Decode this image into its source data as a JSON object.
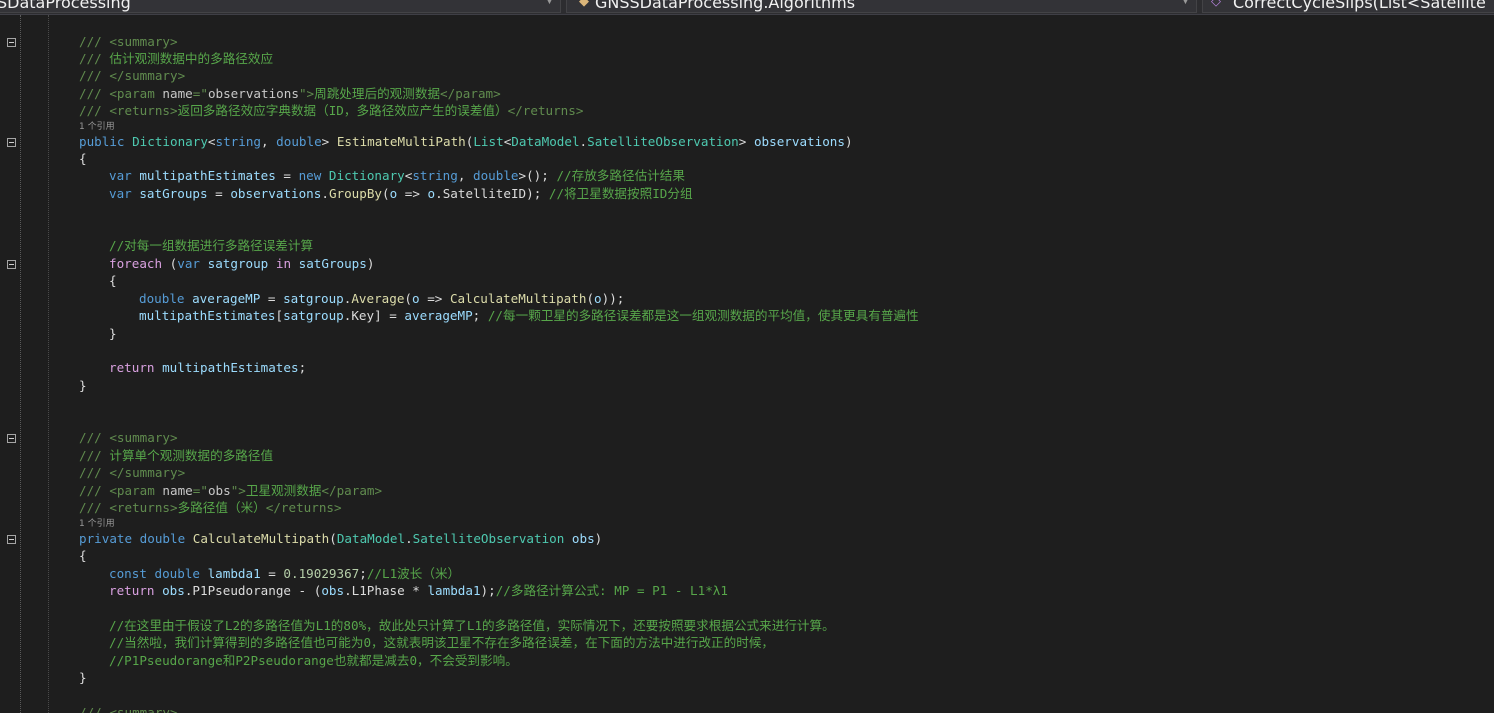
{
  "navbar": {
    "project": "SDataProcessing",
    "class_name": "GNSSDataProcessing.Algorithms",
    "member": "CorrectCycleSlips(List<Satellite",
    "arrow": "▼"
  },
  "code": {
    "l1": {
      "a": "/// ",
      "b": "<summary>"
    },
    "l2": {
      "a": "/// ",
      "b": "估计观测数据中的多路径效应"
    },
    "l3": {
      "a": "/// ",
      "b": "</summary>"
    },
    "l4": {
      "a": "/// ",
      "b": "<param ",
      "c": "name",
      "d": "=\"",
      "e": "observations",
      "f": "\">",
      "g": "周跳处理后的观测数据",
      "h": "</param>"
    },
    "l5": {
      "a": "/// ",
      "b": "<returns>",
      "c": "返回多路径效应字典数据（ID，多路径效应产生的误差值）",
      "d": "</returns>"
    },
    "lens1": "1 个引用",
    "l6": {
      "a": "public ",
      "b": "Dictionary",
      "c": "<",
      "d": "string",
      "e": ", ",
      "f": "double",
      "g": "> ",
      "h": "EstimateMultiPath",
      "i": "(",
      "j": "List",
      "k": "<",
      "l": "DataModel",
      "m": ".",
      "n": "SatelliteObservation",
      "o": "> ",
      "p": "observations",
      "q": ")"
    },
    "l7": "{",
    "l8": {
      "a": "var ",
      "b": "multipathEstimates",
      "c": " = ",
      "d": "new ",
      "e": "Dictionary",
      "f": "<",
      "g": "string",
      "h": ", ",
      "i": "double",
      "j": ">(); ",
      "k": "//存放多路径估计结果"
    },
    "l9": {
      "a": "var ",
      "b": "satGroups",
      "c": " = ",
      "d": "observations",
      "e": ".",
      "f": "GroupBy",
      "g": "(",
      "h": "o",
      "i": " => ",
      "j": "o",
      "k": ".SatelliteID); ",
      "l": "//将卫星数据按照ID分组"
    },
    "l10": "//对每一组数据进行多路径误差计算",
    "l11": {
      "a": "foreach ",
      "b": "(",
      "c": "var ",
      "d": "satgroup ",
      "e": "in ",
      "f": "satGroups",
      "g": ")"
    },
    "l12": "{",
    "l13": {
      "a": "double ",
      "b": "averageMP",
      "c": " = ",
      "d": "satgroup",
      "e": ".",
      "f": "Average",
      "g": "(",
      "h": "o",
      "i": " => ",
      "j": "CalculateMultipath",
      "k": "(",
      "l": "o",
      "m": "));"
    },
    "l14": {
      "a": "multipathEstimates",
      "b": "[",
      "c": "satgroup",
      "d": ".Key] = ",
      "e": "averageMP",
      "f": "; ",
      "g": "//每一颗卫星的多路径误差都是这一组观测数据的平均值，使其更具有普遍性"
    },
    "l15": "}",
    "l16": {
      "a": "return ",
      "b": "multipathEstimates",
      "c": ";"
    },
    "l17": "}",
    "l18": {
      "a": "/// ",
      "b": "<summary>"
    },
    "l19": {
      "a": "/// ",
      "b": "计算单个观测数据的多路径值"
    },
    "l20": {
      "a": "/// ",
      "b": "</summary>"
    },
    "l21": {
      "a": "/// ",
      "b": "<param ",
      "c": "name",
      "d": "=\"",
      "e": "obs",
      "f": "\">",
      "g": "卫星观测数据",
      "h": "</param>"
    },
    "l22": {
      "a": "/// ",
      "b": "<returns>",
      "c": "多路径值（米）",
      "d": "</returns>"
    },
    "lens2": "1 个引用",
    "l23": {
      "a": "private ",
      "b": "double ",
      "c": "CalculateMultipath",
      "d": "(",
      "e": "DataModel",
      "f": ".",
      "g": "SatelliteObservation",
      "h": " ",
      "i": "obs",
      "j": ")"
    },
    "l24": "{",
    "l25": {
      "a": "const ",
      "b": "double ",
      "c": "lambda1",
      "d": " = ",
      "e": "0.19029367",
      "f": ";",
      "g": "//L1波长（米）"
    },
    "l26": {
      "a": "return ",
      "b": "obs",
      "c": ".P1Pseudorange - (",
      "d": "obs",
      "e": ".L1Phase * ",
      "f": "lambda1",
      "g": ");",
      "h": "//多路径计算公式: MP = P1 - L1*λ1"
    },
    "l27": "//在这里由于假设了L2的多路径值为L1的80%，故此处只计算了L1的多路径值，实际情况下，还要按照要求根据公式来进行计算。",
    "l28": "//当然啦，我们计算得到的多路径值也可能为0，这就表明该卫星不存在多路径误差，在下面的方法中进行改正的时候，",
    "l29": "//P1Pseudorange和P2Pseudorange也就都是减去0，不会受到影响。",
    "l30": "}",
    "l31": {
      "a": "/// ",
      "b": "<summary>"
    }
  }
}
